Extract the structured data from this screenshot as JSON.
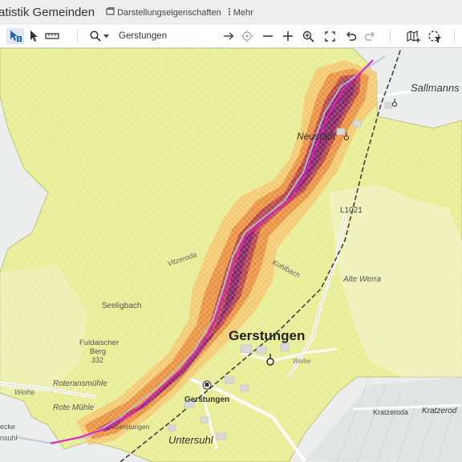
{
  "app": {
    "title": "atistik Gemeinden",
    "display_properties_label": "Darstellungseigenschaften",
    "more_label": "Mehr"
  },
  "search": {
    "value": "Gerstungen"
  },
  "icons": {
    "info_select": "cursor-info-icon",
    "select": "cursor-arrow-icon",
    "measure": "ruler-icon",
    "search": "magnifier-icon",
    "arrow_right": "arrow-right-icon",
    "locate": "crosshair-icon",
    "zoom_out": "minus-icon",
    "zoom_in": "plus-icon",
    "zoom_search": "zoom-magnifier-icon",
    "fullscreen": "fullscreen-icon",
    "undo": "undo-icon",
    "redo": "redo-icon",
    "add_map": "map-plus-icon",
    "filter": "filter-select-icon"
  },
  "colors": {
    "area_fill": "#e8f0a8",
    "hatch": "#f2e44a",
    "zone_outer": "#f5c46a",
    "zone_mid": "#e88a3a",
    "zone_inner": "#b03a4a",
    "zone_core": "#7a1f6e",
    "route": "#e020c0",
    "railway": "#404040"
  },
  "map": {
    "labels": {
      "sallmannshausen": "Sallmanns",
      "neustaedt": "Neustädt",
      "road_l1021": "L1021",
      "alte_werra": "Alte Werra",
      "seeligbach": "Seeligbach",
      "fuldaischer_berg": "Fuldaischer",
      "berg": "Berg",
      "berg_height": "332",
      "gerstungen_town": "Gerstungen",
      "gerstungen_station": "Gerstungen",
      "rote_muehle": "Rote Mühle",
      "roteranmuehle": "Roteransmühle",
      "untersuhl": "Untersuhl",
      "kratzeroda_1": "Kratzeroda",
      "kratzeroda_2": "Kratzerod",
      "weihe": "Weihe",
      "nsuhl": "nsuhl",
      "ecke": "ecke",
      "vitzeroda": "Vitzeroda",
      "koelbach": "Kohlbach",
      "weihe2": "Weihe",
      "gerstungen_small": "Gerstungen"
    }
  }
}
